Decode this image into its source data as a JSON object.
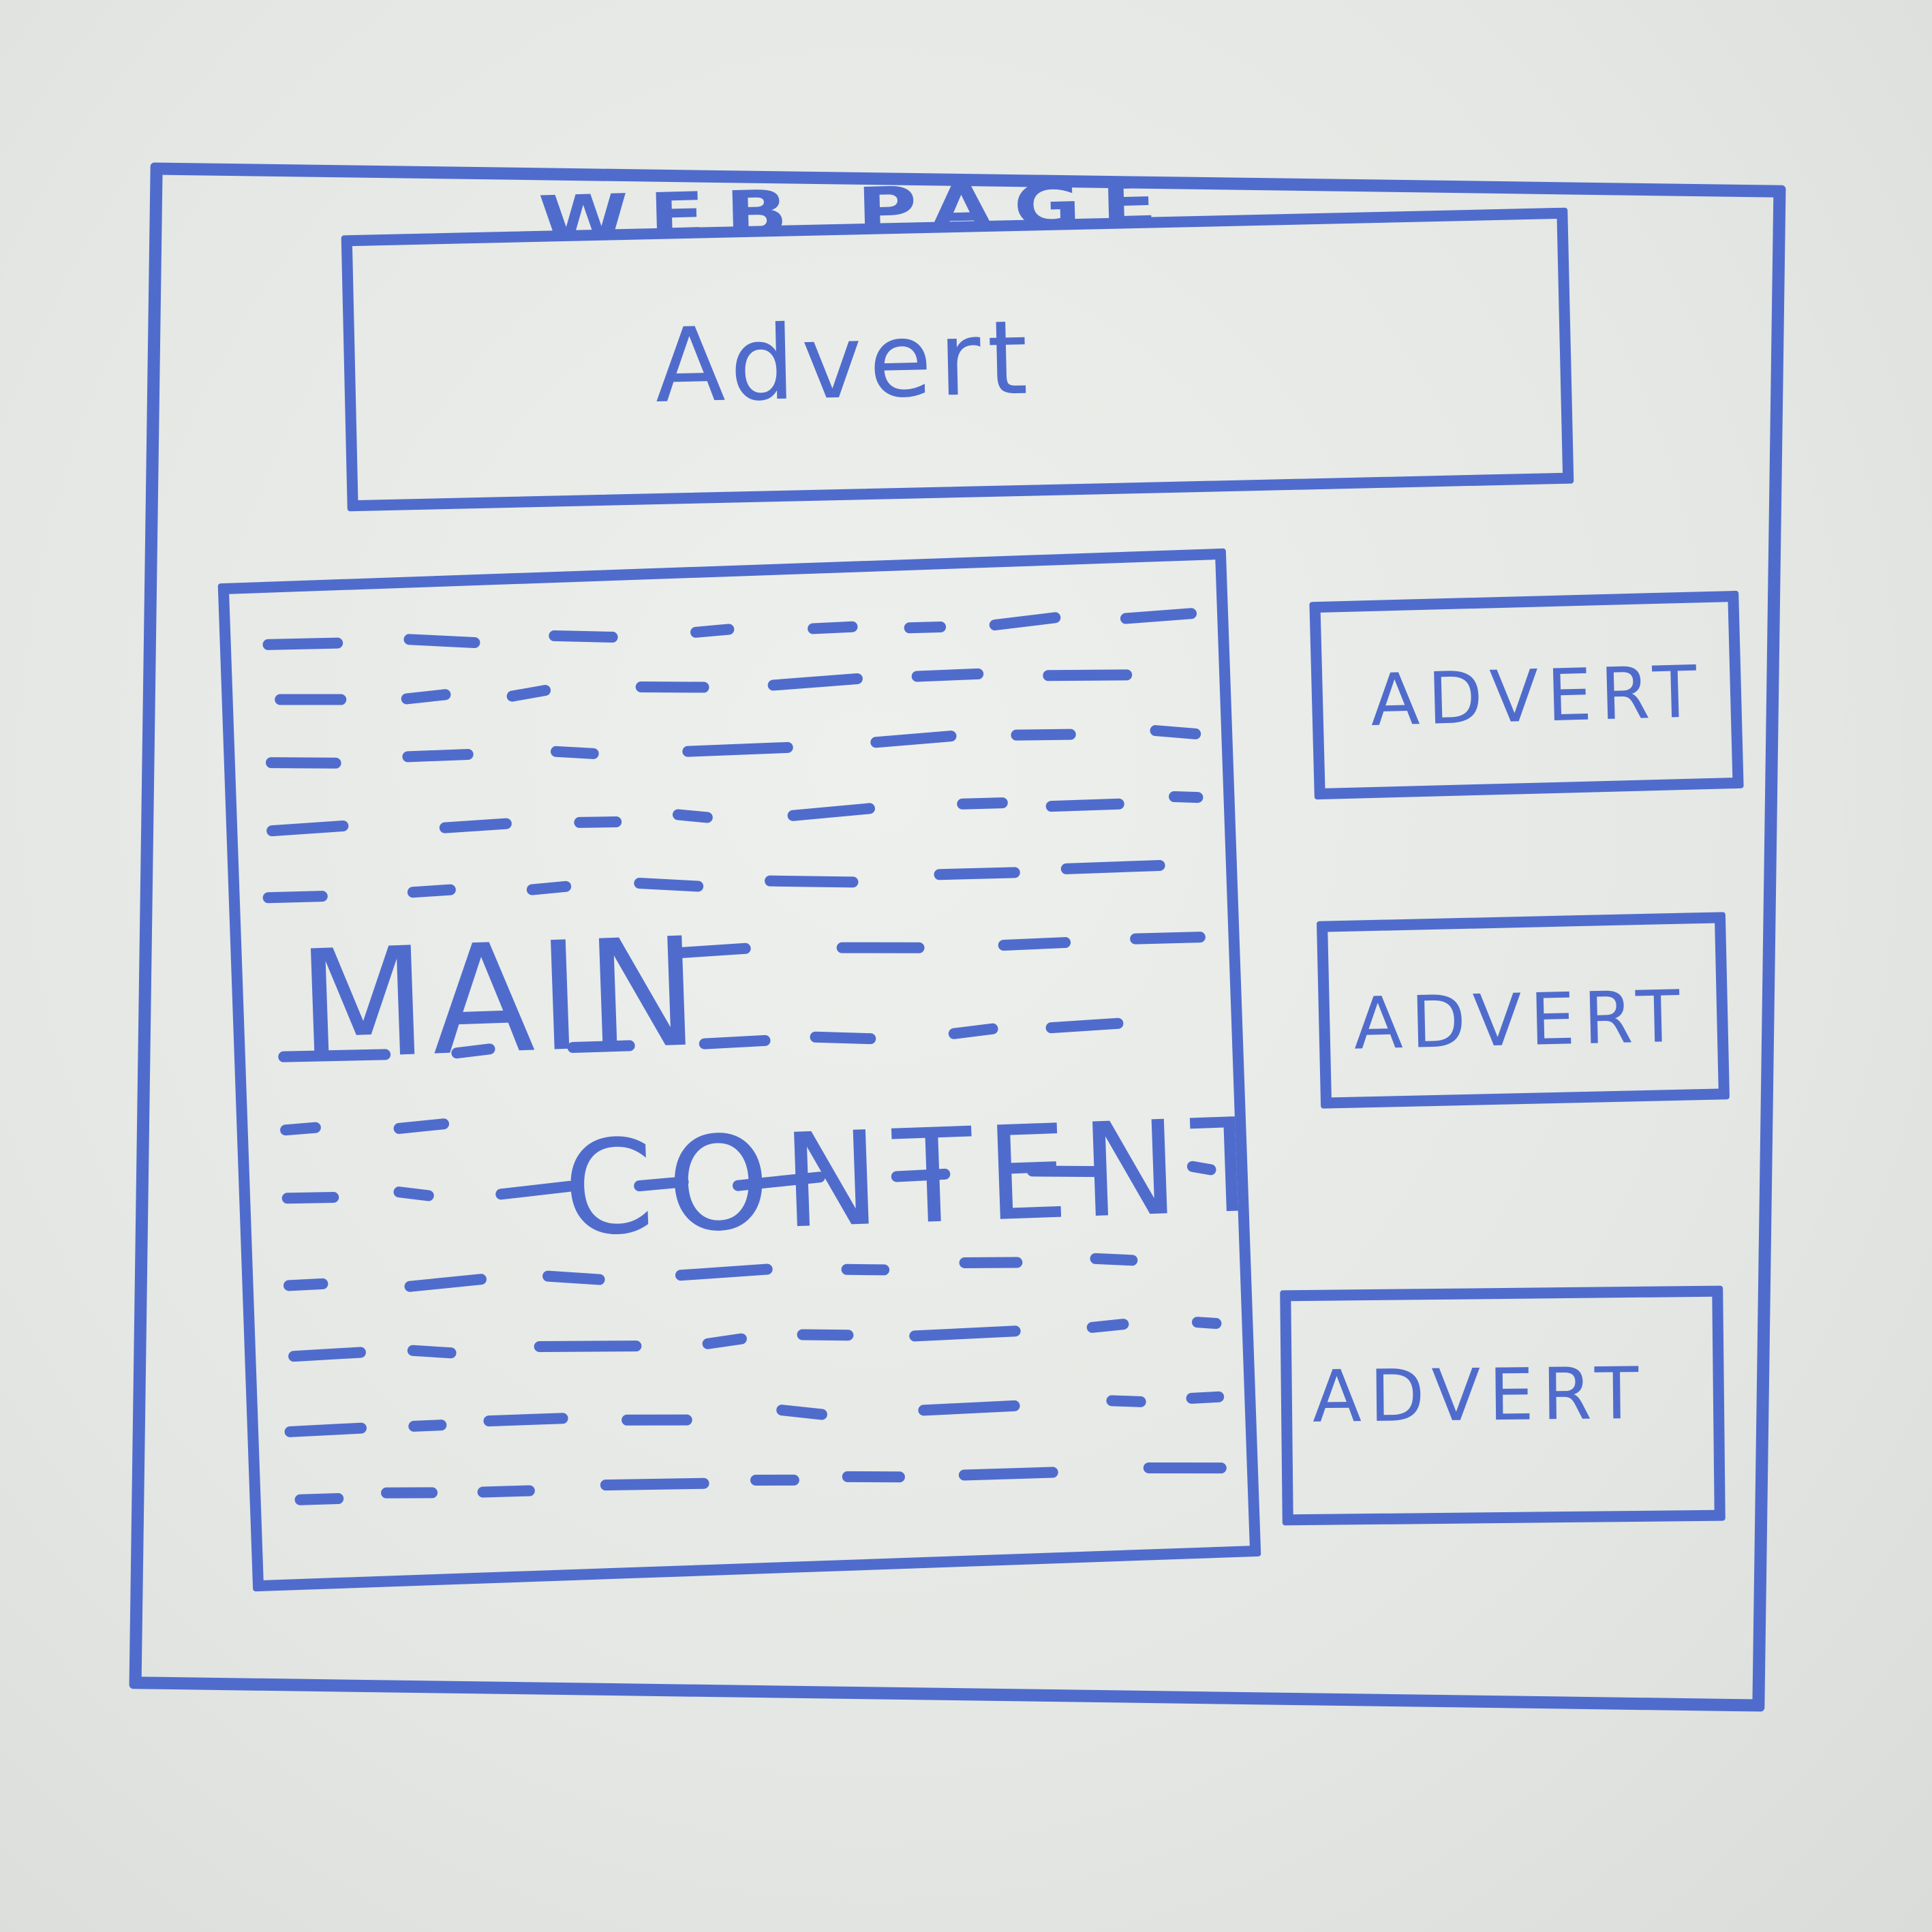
{
  "sketch": {
    "page_title": "WEB PAGE",
    "top_advert": "Advert",
    "main_content": {
      "line1": "MAIN",
      "line2": "CONTENT"
    },
    "side_adverts": [
      "ADVERT",
      "ADVERT",
      "ADVERT"
    ]
  },
  "colors": {
    "ink": "#4f6ccd",
    "paper": "#e6e9e5"
  }
}
